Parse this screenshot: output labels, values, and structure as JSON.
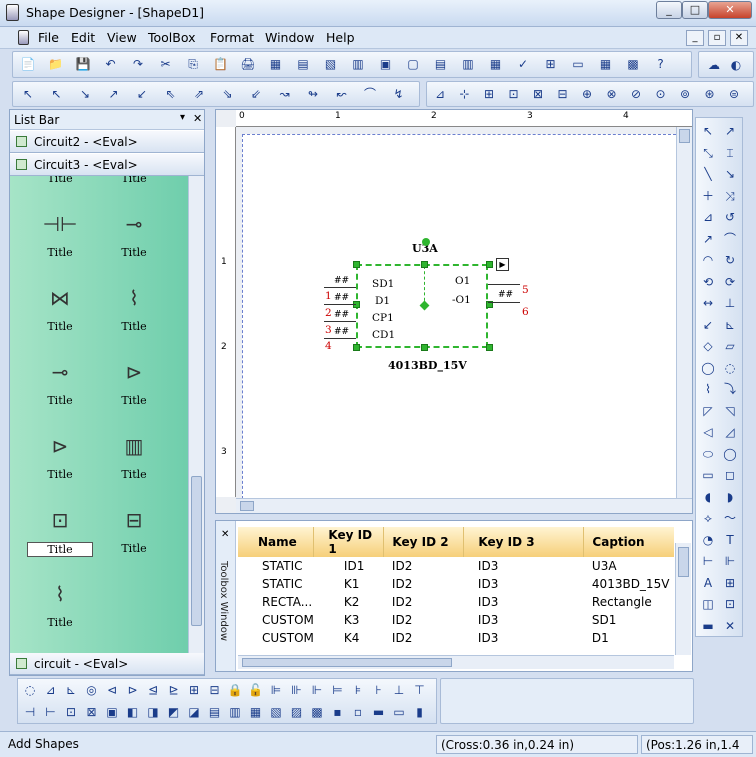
{
  "window": {
    "title": "Shape Designer - [ShapeD1]",
    "min": "_",
    "max": "□",
    "close": "✕"
  },
  "menu": [
    "File",
    "Edit",
    "View",
    "ToolBox",
    "Format",
    "Window",
    "Help"
  ],
  "mdi_buttons": [
    "_",
    "▫",
    "✕"
  ],
  "toolbar1": [
    "📄",
    "📁",
    "💾",
    "↶",
    "↷",
    "✂",
    "⎘",
    "📋",
    "🖨",
    "▦",
    "▤",
    "▧",
    "▥",
    "▣",
    "▢",
    "▤",
    "▥",
    "▦",
    "✓",
    "⊞",
    "▭",
    "▦",
    "▩",
    "?"
  ],
  "toolbar2": [
    "↖",
    "↖",
    "↘",
    "↗",
    "↙",
    "⇖",
    "⇗",
    "⇘",
    "⇙",
    "↝",
    "↬",
    "↜",
    "⌒",
    "↯"
  ],
  "toolbar3": [
    "⊿",
    "⊹",
    "⊞",
    "⊡",
    "⊠",
    "⊟",
    "⊕",
    "⊗",
    "⊘",
    "⊙",
    "⊚",
    "⊛",
    "⊜"
  ],
  "listbar": {
    "title": "List Bar",
    "pin": "▾",
    "close": "✕",
    "groups": [
      {
        "label": "Circuit2 - <Eval>"
      },
      {
        "label": "Circuit3 - <Eval>"
      }
    ],
    "footer_group": "circuit - <Eval>",
    "shapes": [
      {
        "glyph": "",
        "label": "Title"
      },
      {
        "glyph": "",
        "label": "Title"
      },
      {
        "glyph": "⊣⊢",
        "label": "Title"
      },
      {
        "glyph": "⊸",
        "label": "Title"
      },
      {
        "glyph": "⋈",
        "label": "Title"
      },
      {
        "glyph": "⌇",
        "label": "Title"
      },
      {
        "glyph": "⊸",
        "label": "Title"
      },
      {
        "glyph": "⊳",
        "label": "Title"
      },
      {
        "glyph": "⊳",
        "label": "Title"
      },
      {
        "glyph": "▥",
        "label": "Title"
      },
      {
        "glyph": "⊡",
        "label": "Title",
        "selected": true
      },
      {
        "glyph": "⊟",
        "label": "Title"
      },
      {
        "glyph": "⌇",
        "label": "Title"
      }
    ]
  },
  "ruler": {
    "h": [
      "0",
      "1",
      "2",
      "3",
      "4"
    ],
    "v": [
      "1",
      "2",
      "3"
    ]
  },
  "component": {
    "ref": "U3A",
    "name": "4013BD_15V",
    "in_pins": [
      "SD1",
      "D1",
      "CP1",
      "CD1"
    ],
    "out_pins": [
      "O1",
      "-O1"
    ],
    "pin_nums_left": [
      "1",
      "2",
      "3",
      "4"
    ],
    "pin_nums_right": [
      "5",
      "6"
    ],
    "hash": "##"
  },
  "toolbox_window": {
    "title": "Toolbox Window",
    "close": "✕",
    "columns": [
      "Name",
      "Key ID 1",
      "Key ID 2",
      "Key ID 3",
      "Caption"
    ],
    "rows": [
      [
        "STATIC",
        "ID1",
        "ID2",
        "ID3",
        "U3A"
      ],
      [
        "STATIC",
        "K1",
        "ID2",
        "ID3",
        "4013BD_15V"
      ],
      [
        "RECTA...",
        "K2",
        "ID2",
        "ID3",
        "Rectangle"
      ],
      [
        "CUSTOM",
        "K3",
        "ID2",
        "ID3",
        "SD1"
      ],
      [
        "CUSTOM",
        "K4",
        "ID2",
        "ID3",
        "D1"
      ]
    ]
  },
  "right_toolbar": [
    "↖",
    "↗",
    "⤡",
    "⌶",
    "╲",
    "↘",
    "＋",
    "⤨",
    "⊿",
    "↺",
    "↗",
    "⌒",
    "◠",
    "↻",
    "⟲",
    "⟳",
    "↔",
    "⊥",
    "↙",
    "⊾",
    "◇",
    "▱",
    "◯",
    "◌",
    "⌇",
    "⤵",
    "◸",
    "◹",
    "◁",
    "◿",
    "⬭",
    "◯",
    "▭",
    "◻",
    "◖",
    "◗",
    "⟡",
    "〜",
    "◔",
    "T",
    "⊢",
    "⊩",
    "A",
    "⊞",
    "◫",
    "⊡",
    "▬",
    "✕"
  ],
  "bottom_toolbar": [
    "◌",
    "⊿",
    "⊾",
    "◎",
    "⊲",
    "⊳",
    "⊴",
    "⊵",
    "⊞",
    "⊟",
    "🔒",
    "🔓",
    "⊫",
    "⊪",
    "⊩",
    "⊨",
    "⊧",
    "⊦",
    "⊥",
    "⊤",
    "⊣",
    "⊢",
    "⊡",
    "⊠",
    "▣",
    "◧",
    "◨",
    "◩",
    "◪",
    "▤",
    "▥",
    "▦",
    "▧",
    "▨",
    "▩",
    "▪",
    "▫",
    "▬",
    "▭",
    "▮"
  ],
  "status": {
    "left": "Add Shapes",
    "cross": "(Cross:0.36 in,0.24 in)",
    "pos": "(Pos:1.26 in,1.4"
  },
  "colors": {
    "shapes_bg": "#7fd6b3",
    "selection": "#2fb52f",
    "pin_numbers": "#cc0000",
    "header": "#f6cf79"
  }
}
